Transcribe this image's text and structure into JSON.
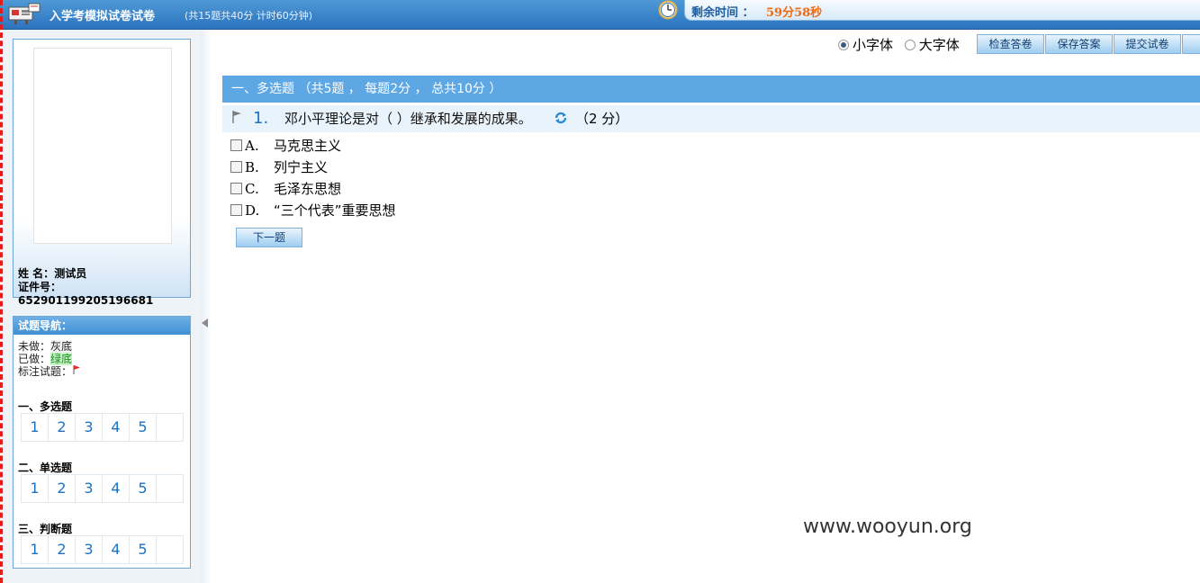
{
  "header": {
    "title": "入学考模拟试卷试卷",
    "meta": "(共15题共40分  计时60分钟)",
    "timer_label": "剩余时间 ：",
    "timer_value": "59分58秒"
  },
  "candidate": {
    "name_label": "姓  名：",
    "name": "测试员",
    "id_label": "证件号：",
    "id": "652901199205196681"
  },
  "nav": {
    "title": "试题导航：",
    "legend_undone_label": "未做：",
    "legend_undone_value": "灰底",
    "legend_done_label": "已做：",
    "legend_done_value": "绿底",
    "legend_flag_label": "标注试题：",
    "sections": [
      {
        "title": "一、多选题",
        "numbers": [
          "1",
          "2",
          "3",
          "4",
          "5"
        ]
      },
      {
        "title": "二、单选题",
        "numbers": [
          "1",
          "2",
          "3",
          "4",
          "5"
        ]
      },
      {
        "title": "三、判断题",
        "numbers": [
          "1",
          "2",
          "3",
          "4",
          "5"
        ]
      }
    ]
  },
  "toolbar": {
    "small_font": "小字体",
    "large_font": "大字体",
    "check_answers": "检查答卷",
    "save_answers": "保存答案",
    "submit": "提交试卷",
    "selected_font": "small"
  },
  "section": {
    "heading": "一、多选题  （共5题 ，  每题2分  ，  总共10分  ）"
  },
  "question": {
    "number": "1.",
    "text": "邓小平理论是对（  ）继承和发展的成果。",
    "score": "（2 分）",
    "options": [
      {
        "key": "A.",
        "text": "马克思主义"
      },
      {
        "key": "B.",
        "text": "列宁主义"
      },
      {
        "key": "C.",
        "text": "毛泽东思想"
      },
      {
        "key": "D.",
        "text": "“三个代表”重要思想"
      }
    ],
    "next_label": "下一题"
  },
  "watermark": "www.wooyun.org",
  "colors": {
    "header_blue": "#2b74bf",
    "timer_orange": "#f26a10",
    "section_blue": "#5ca7e4",
    "link_blue": "#1b72c4"
  }
}
